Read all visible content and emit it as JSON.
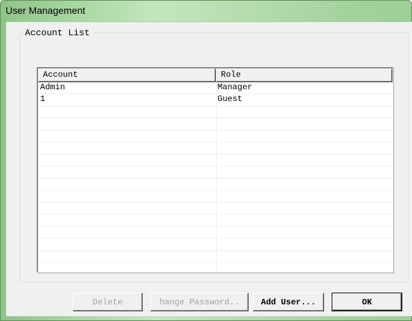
{
  "window": {
    "title": "User Management"
  },
  "account_list": {
    "group_label": "Account List",
    "columns": [
      "Account",
      "Role"
    ],
    "rows": [
      {
        "account": "Admin",
        "role": "Manager"
      },
      {
        "account": "1",
        "role": "Guest"
      }
    ]
  },
  "buttons": {
    "delete": "Delete",
    "change_password": "hange Password..",
    "add_user": "Add User...",
    "ok": "OK"
  },
  "colors": {
    "titlebar_accent": "#a9d7a2",
    "dialog_face": "#f0f0f0",
    "disabled_text": "#a0a0a0"
  }
}
